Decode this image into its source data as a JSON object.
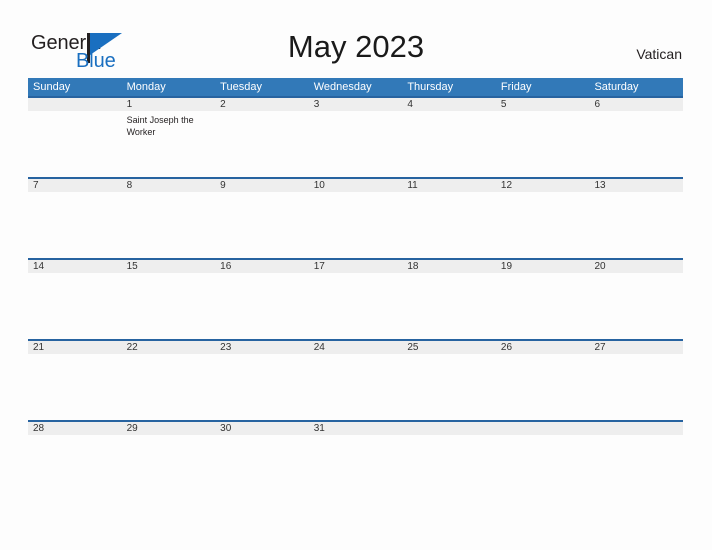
{
  "brand": {
    "name_part1": "General",
    "name_part2": "Blue",
    "mark": "triangle-logo-icon",
    "color_dark": "#231f20",
    "color_blue": "#1a6fc0"
  },
  "header": {
    "title": "May 2023",
    "region": "Vatican",
    "header_bg": "#3279b8",
    "band_bg": "#eeeeee",
    "band_border": "#2763a0"
  },
  "weekdays": [
    "Sunday",
    "Monday",
    "Tuesday",
    "Wednesday",
    "Thursday",
    "Friday",
    "Saturday"
  ],
  "weeks": [
    {
      "days": [
        {
          "date": "",
          "events": []
        },
        {
          "date": "1",
          "events": [
            "Saint Joseph the Worker"
          ]
        },
        {
          "date": "2",
          "events": []
        },
        {
          "date": "3",
          "events": []
        },
        {
          "date": "4",
          "events": []
        },
        {
          "date": "5",
          "events": []
        },
        {
          "date": "6",
          "events": []
        }
      ]
    },
    {
      "days": [
        {
          "date": "7",
          "events": []
        },
        {
          "date": "8",
          "events": []
        },
        {
          "date": "9",
          "events": []
        },
        {
          "date": "10",
          "events": []
        },
        {
          "date": "11",
          "events": []
        },
        {
          "date": "12",
          "events": []
        },
        {
          "date": "13",
          "events": []
        }
      ]
    },
    {
      "days": [
        {
          "date": "14",
          "events": []
        },
        {
          "date": "15",
          "events": []
        },
        {
          "date": "16",
          "events": []
        },
        {
          "date": "17",
          "events": []
        },
        {
          "date": "18",
          "events": []
        },
        {
          "date": "19",
          "events": []
        },
        {
          "date": "20",
          "events": []
        }
      ]
    },
    {
      "days": [
        {
          "date": "21",
          "events": []
        },
        {
          "date": "22",
          "events": []
        },
        {
          "date": "23",
          "events": []
        },
        {
          "date": "24",
          "events": []
        },
        {
          "date": "25",
          "events": []
        },
        {
          "date": "26",
          "events": []
        },
        {
          "date": "27",
          "events": []
        }
      ]
    },
    {
      "days": [
        {
          "date": "28",
          "events": []
        },
        {
          "date": "29",
          "events": []
        },
        {
          "date": "30",
          "events": []
        },
        {
          "date": "31",
          "events": []
        },
        {
          "date": "",
          "events": []
        },
        {
          "date": "",
          "events": []
        },
        {
          "date": "",
          "events": []
        }
      ]
    }
  ]
}
